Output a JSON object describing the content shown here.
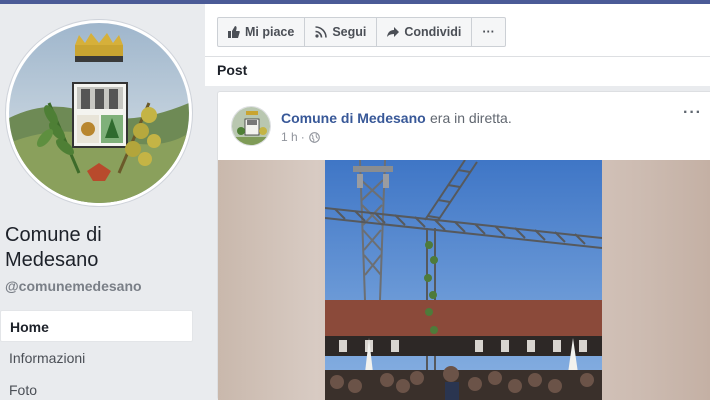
{
  "page": {
    "name": "Comune di Medesano",
    "handle": "@comunemedesano"
  },
  "nav": {
    "items": [
      {
        "label": "Home",
        "active": true
      },
      {
        "label": "Informazioni",
        "active": false
      },
      {
        "label": "Foto",
        "active": false
      }
    ]
  },
  "actions": {
    "like_label": "Mi piace",
    "follow_label": "Segui",
    "share_label": "Condividi",
    "more_label": "···"
  },
  "section": {
    "title": "Post"
  },
  "post": {
    "author": "Comune di Medesano",
    "verb": "era in diretta.",
    "time": "1 h",
    "privacy_icon": "globe-icon",
    "menu_label": "···"
  },
  "colors": {
    "topbar": "#4b5b97",
    "link": "#385898",
    "background": "#e9ebee"
  }
}
